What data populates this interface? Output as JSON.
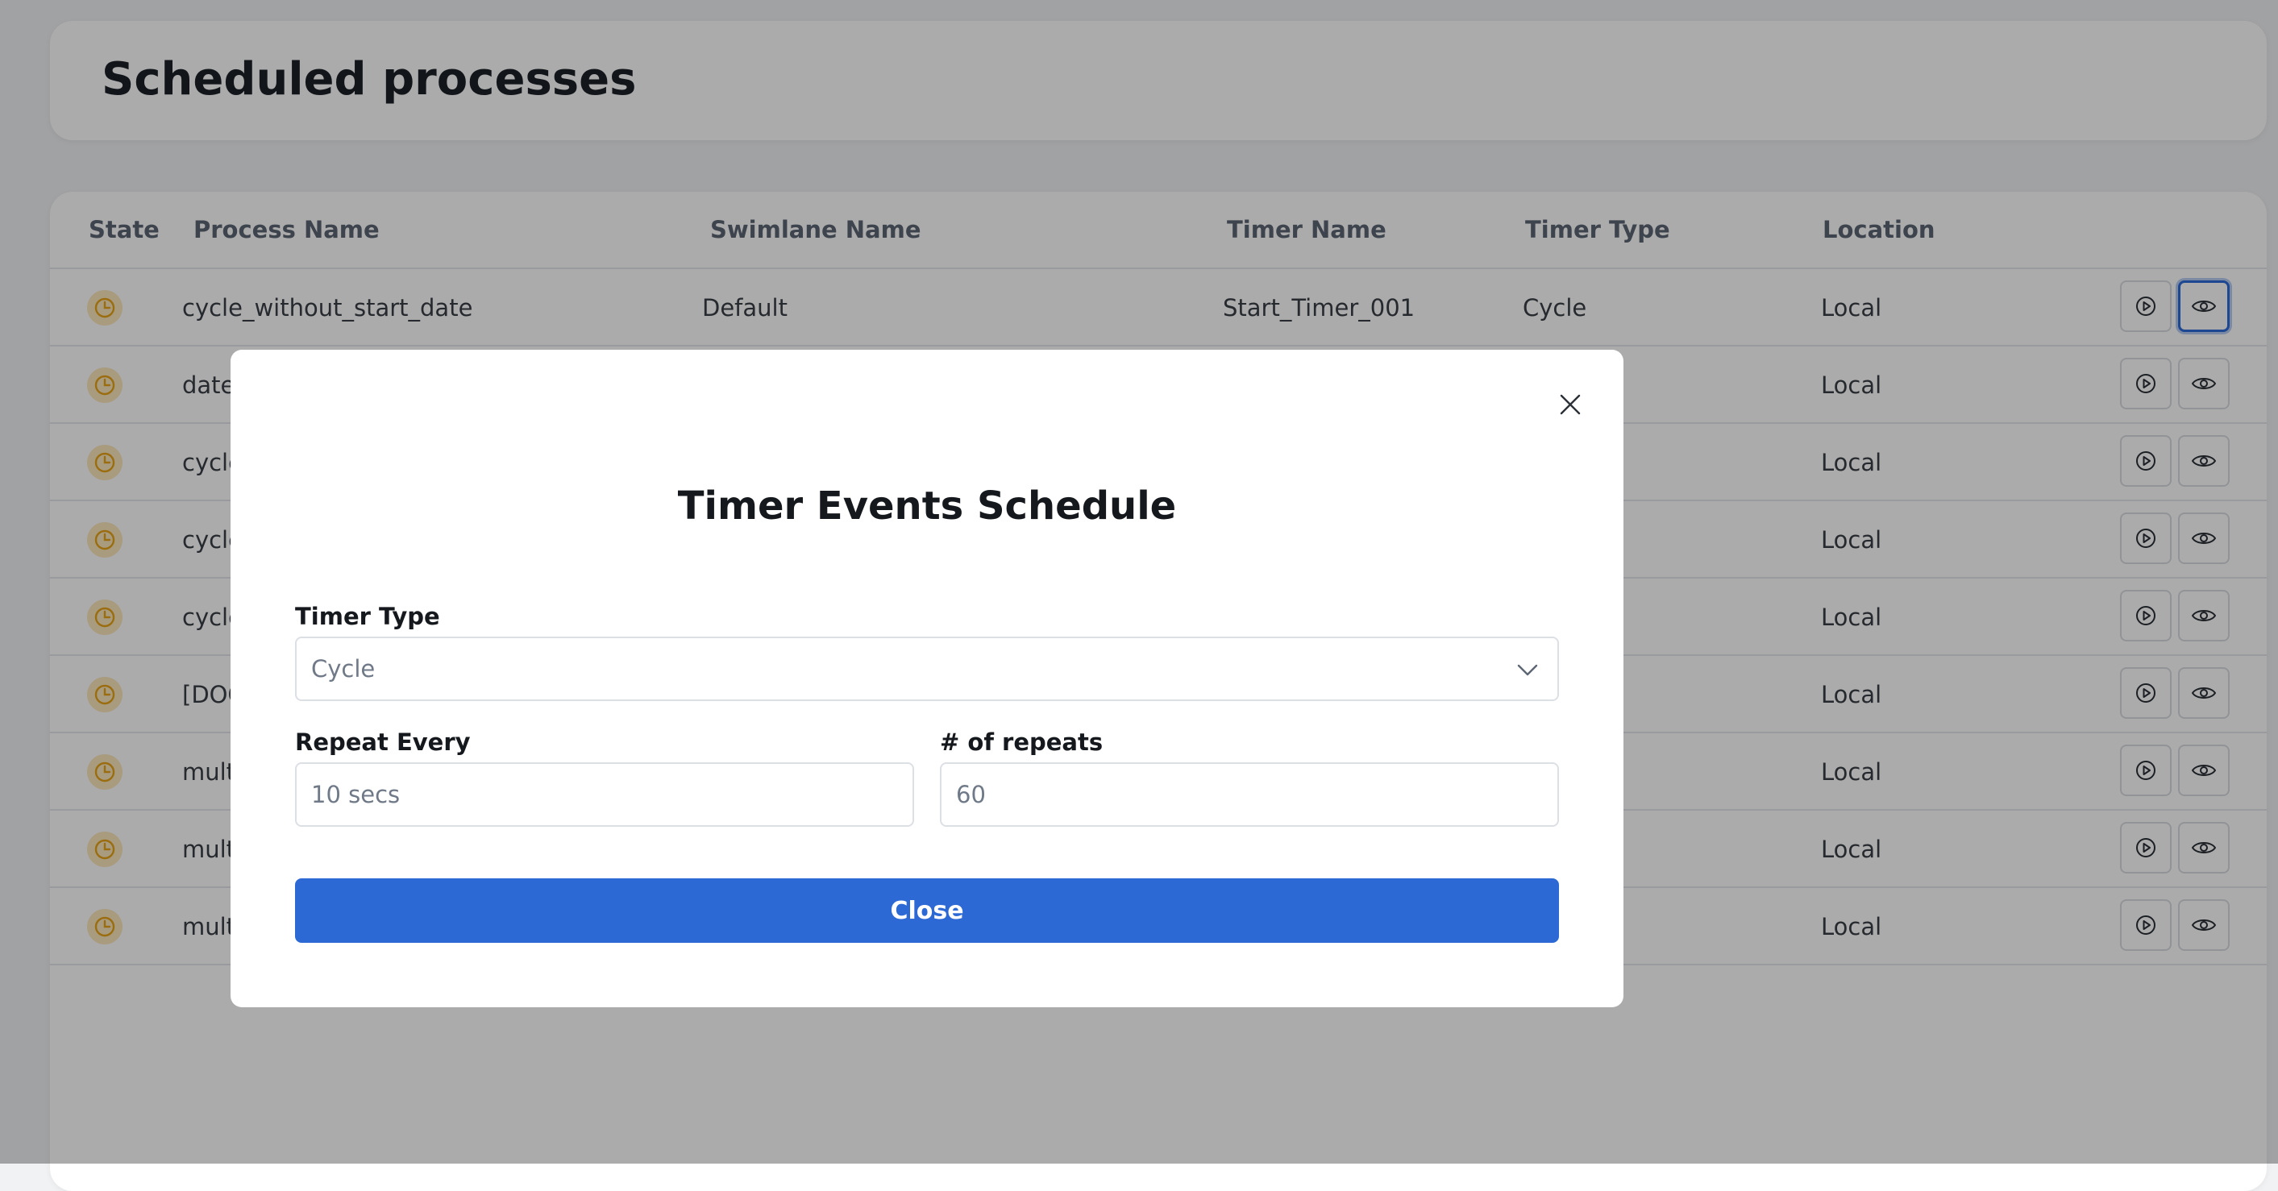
{
  "page": {
    "title": "Scheduled processes"
  },
  "table": {
    "columns": [
      "State",
      "Process Name",
      "Swimlane Name",
      "Timer Name",
      "Timer Type",
      "Location"
    ],
    "rows": [
      {
        "process": "cycle_without_start_date",
        "swimlane": "Default",
        "timer_name": "Start_Timer_001",
        "timer_type": "Cycle",
        "location": "Local"
      },
      {
        "process": "date",
        "swimlane": "",
        "timer_name": "",
        "timer_type": "",
        "location": "Local"
      },
      {
        "process": "cycle",
        "swimlane": "",
        "timer_name": "",
        "timer_type": "",
        "location": "Local"
      },
      {
        "process": "cycle",
        "swimlane": "",
        "timer_name": "",
        "timer_type": "",
        "location": "Local"
      },
      {
        "process": "cycle",
        "swimlane": "",
        "timer_name": "",
        "timer_type": "",
        "location": "Local"
      },
      {
        "process": "[DOC",
        "swimlane": "",
        "timer_name": "",
        "timer_type": "",
        "location": "Local"
      },
      {
        "process": "mult",
        "swimlane": "",
        "timer_name": "",
        "timer_type": "",
        "location": "Local"
      },
      {
        "process": "mult",
        "swimlane": "",
        "timer_name": "",
        "timer_type": "",
        "location": "Local"
      },
      {
        "process": "mult",
        "swimlane": "",
        "timer_name": "",
        "timer_type": "",
        "location": "Local"
      }
    ],
    "icons": {
      "state": "clock-icon",
      "run": "play-icon",
      "view": "eye-icon"
    }
  },
  "modal": {
    "title": "Timer Events Schedule",
    "timer_type_label": "Timer Type",
    "timer_type_value": "Cycle",
    "repeat_every_label": "Repeat Every",
    "repeat_every_value": "10 secs",
    "repeats_label": "# of repeats",
    "repeats_value": "60",
    "close_button": "Close"
  },
  "colors": {
    "primary": "#2d69d4",
    "state_icon": "#e8a317",
    "focus": "#2d6ad8"
  }
}
